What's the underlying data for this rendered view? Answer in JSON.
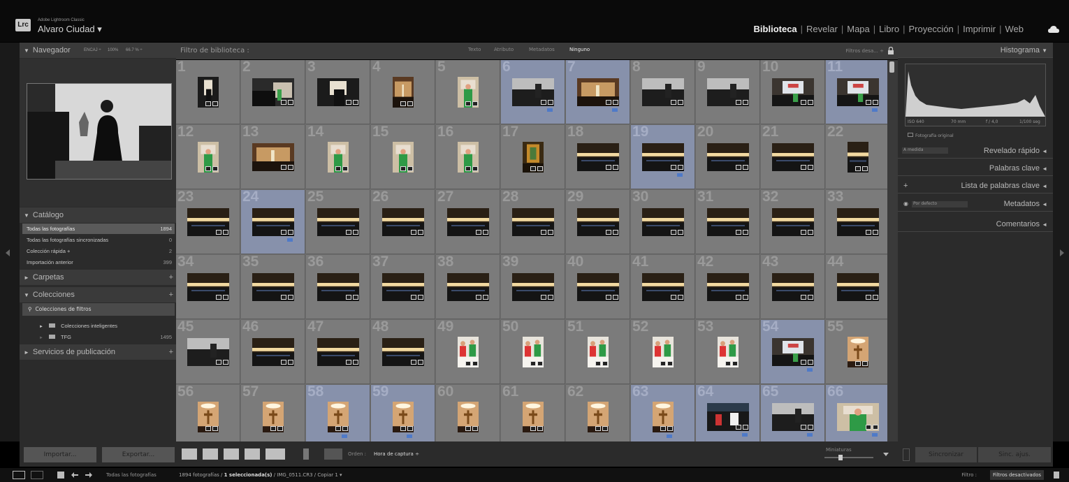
{
  "app": {
    "product": "Adobe Lightroom Classic",
    "logo": "Lrc",
    "user": "Alvaro Ciudad ▾"
  },
  "modules": [
    {
      "label": "Biblioteca",
      "active": true
    },
    {
      "label": "Revelar",
      "active": false
    },
    {
      "label": "Mapa",
      "active": false
    },
    {
      "label": "Libro",
      "active": false
    },
    {
      "label": "Proyección",
      "active": false
    },
    {
      "label": "Imprimir",
      "active": false
    },
    {
      "label": "Web",
      "active": false
    }
  ],
  "navigator": {
    "title": "Navegador",
    "fit": "ENCAJ ÷",
    "z1": "100%",
    "z2": "66.7 % ÷"
  },
  "catalog": {
    "title": "Catálogo",
    "rows": [
      {
        "label": "Todas las fotografías",
        "count": "1894",
        "selected": true
      },
      {
        "label": "Todas las fotografías sincronizadas",
        "count": "0",
        "selected": false
      },
      {
        "label": "Colección rápida +",
        "count": "2",
        "selected": false
      },
      {
        "label": "Importación anterior",
        "count": "399",
        "selected": false
      }
    ]
  },
  "folders": {
    "title": "Carpetas"
  },
  "collections": {
    "title": "Colecciones",
    "filter": "Colecciones de filtros",
    "smart": "Colecciones inteligentes",
    "tfg": "TFG",
    "tfg_count": "1495"
  },
  "publish": {
    "title": "Servicios de publicación"
  },
  "left_buttons": {
    "import": "Importar...",
    "export": "Exportar..."
  },
  "filterbar": {
    "title": "Filtro de biblioteca :",
    "tabs": [
      "Texto",
      "Atributo",
      "Metadatos",
      "Ninguno"
    ],
    "active": "Ninguno",
    "right": "Filtros desa... ÷"
  },
  "grid": {
    "columns": 11,
    "cells": [
      {
        "n": "1",
        "o": "p",
        "s": "dark"
      },
      {
        "n": "2",
        "o": "l",
        "s": "crowd"
      },
      {
        "n": "3",
        "o": "l",
        "s": "dark"
      },
      {
        "n": "4",
        "o": "p",
        "s": "warm"
      },
      {
        "n": "5",
        "o": "p",
        "s": "priest"
      },
      {
        "n": "6",
        "o": "l",
        "s": "bw",
        "sel": true
      },
      {
        "n": "7",
        "o": "l",
        "s": "warm",
        "sel": true
      },
      {
        "n": "8",
        "o": "l",
        "s": "bw"
      },
      {
        "n": "9",
        "o": "l",
        "s": "bw"
      },
      {
        "n": "10",
        "o": "l",
        "s": "screen"
      },
      {
        "n": "11",
        "o": "l",
        "s": "screen",
        "sel": true
      },
      {
        "n": "12",
        "o": "p",
        "s": "priest"
      },
      {
        "n": "13",
        "o": "l",
        "s": "warm"
      },
      {
        "n": "14",
        "o": "p",
        "s": "priest"
      },
      {
        "n": "15",
        "o": "p",
        "s": "priest"
      },
      {
        "n": "16",
        "o": "p",
        "s": "priest"
      },
      {
        "n": "17",
        "o": "p",
        "s": "stained"
      },
      {
        "n": "18",
        "o": "l",
        "s": "church"
      },
      {
        "n": "19",
        "o": "l",
        "s": "church",
        "sel": true
      },
      {
        "n": "20",
        "o": "l",
        "s": "church"
      },
      {
        "n": "21",
        "o": "l",
        "s": "church"
      },
      {
        "n": "22",
        "o": "p",
        "s": "church"
      },
      {
        "n": "23",
        "o": "l",
        "s": "church"
      },
      {
        "n": "24",
        "o": "l",
        "s": "church",
        "sel": true
      },
      {
        "n": "25",
        "o": "l",
        "s": "church"
      },
      {
        "n": "26",
        "o": "l",
        "s": "church"
      },
      {
        "n": "27",
        "o": "l",
        "s": "church"
      },
      {
        "n": "28",
        "o": "l",
        "s": "church"
      },
      {
        "n": "29",
        "o": "l",
        "s": "church"
      },
      {
        "n": "30",
        "o": "l",
        "s": "church"
      },
      {
        "n": "31",
        "o": "l",
        "s": "church"
      },
      {
        "n": "32",
        "o": "l",
        "s": "church"
      },
      {
        "n": "33",
        "o": "l",
        "s": "church"
      },
      {
        "n": "34",
        "o": "l",
        "s": "church"
      },
      {
        "n": "35",
        "o": "l",
        "s": "church"
      },
      {
        "n": "36",
        "o": "l",
        "s": "church"
      },
      {
        "n": "37",
        "o": "l",
        "s": "church"
      },
      {
        "n": "38",
        "o": "l",
        "s": "church"
      },
      {
        "n": "39",
        "o": "l",
        "s": "church"
      },
      {
        "n": "40",
        "o": "l",
        "s": "church"
      },
      {
        "n": "41",
        "o": "l",
        "s": "church"
      },
      {
        "n": "42",
        "o": "l",
        "s": "church"
      },
      {
        "n": "43",
        "o": "l",
        "s": "church"
      },
      {
        "n": "44",
        "o": "l",
        "s": "church"
      },
      {
        "n": "45",
        "o": "l",
        "s": "bw"
      },
      {
        "n": "46",
        "o": "l",
        "s": "church"
      },
      {
        "n": "47",
        "o": "l",
        "s": "church"
      },
      {
        "n": "48",
        "o": "l",
        "s": "church"
      },
      {
        "n": "49",
        "o": "p",
        "s": "altar"
      },
      {
        "n": "50",
        "o": "p",
        "s": "altar"
      },
      {
        "n": "51",
        "o": "p",
        "s": "altar"
      },
      {
        "n": "52",
        "o": "p",
        "s": "altar"
      },
      {
        "n": "53",
        "o": "p",
        "s": "altar"
      },
      {
        "n": "54",
        "o": "l",
        "s": "screen",
        "sel": true
      },
      {
        "n": "55",
        "o": "p",
        "s": "cross"
      },
      {
        "n": "56",
        "o": "p",
        "s": "cross"
      },
      {
        "n": "57",
        "o": "p",
        "s": "cross"
      },
      {
        "n": "58",
        "o": "p",
        "s": "cross",
        "sel": true
      },
      {
        "n": "59",
        "o": "p",
        "s": "cross",
        "sel": true
      },
      {
        "n": "60",
        "o": "p",
        "s": "cross"
      },
      {
        "n": "61",
        "o": "p",
        "s": "cross"
      },
      {
        "n": "62",
        "o": "p",
        "s": "cross"
      },
      {
        "n": "63",
        "o": "p",
        "s": "cross",
        "sel": true
      },
      {
        "n": "64",
        "o": "l",
        "s": "people",
        "sel": true
      },
      {
        "n": "65",
        "o": "l",
        "s": "bw",
        "sel": true
      },
      {
        "n": "66",
        "o": "l",
        "s": "priest",
        "sel": true
      }
    ]
  },
  "toolbar": {
    "order_label": "Orden :",
    "order_value": "Hora de captura ÷",
    "thumbs_label": "Miniaturas"
  },
  "right": {
    "histogram": "Histograma",
    "iso": "ISO 640",
    "focal": "70 mm",
    "aperture": "f / 4,0",
    "shutter": "1/100 seg",
    "original": "Fotografía original",
    "quick_preset": "A medida",
    "quick": "Revelado rápido",
    "keywords": "Palabras clave",
    "keyword_list": "Lista de palabras clave",
    "meta_preset": "Por defecto",
    "metadata": "Metadatos",
    "comments": "Comentarios",
    "sync": "Sincronizar",
    "syncset": "Sinc. ajus."
  },
  "filmstrip": {
    "path": "Todas las fotografías",
    "info_pre": "1894 fotografías /",
    "info_bold": "1 seleccionada(s)",
    "info_post": "/ IMG_0511.CR3 / Copiar 1 ▾",
    "filter_label": "Filtro :",
    "filter_value": "Filtros desactivados"
  },
  "colors": {
    "panel": "#2b2b2b",
    "cell": "#7b7b7b",
    "selected": "#8791ab",
    "accent_flag": "#4f7ac8"
  }
}
